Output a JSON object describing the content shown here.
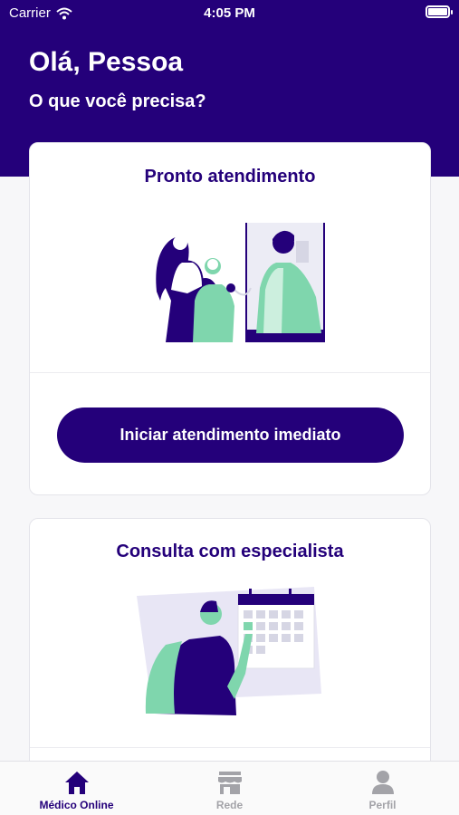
{
  "status_bar": {
    "carrier": "Carrier",
    "time": "4:05 PM",
    "battery_level": 0.9
  },
  "header": {
    "greeting": "Olá, Pessoa",
    "subtitle": "O que você precisa?"
  },
  "cards": [
    {
      "title": "Pronto atendimento",
      "button_label": "Iniciar atendimento imediato",
      "illustration": "doctor-video-call-illustration"
    },
    {
      "title": "Consulta com especialista",
      "illustration": "calendar-appointment-illustration"
    }
  ],
  "tab_bar": {
    "items": [
      {
        "label": "Médico Online",
        "icon": "home-icon",
        "active": true
      },
      {
        "label": "Rede",
        "icon": "store-icon",
        "active": false
      },
      {
        "label": "Perfil",
        "icon": "user-icon",
        "active": false
      }
    ]
  },
  "colors": {
    "primary": "#24007a",
    "accent": "#7fd6ad",
    "inactive": "#a3a3a8",
    "background": "#f7f7f9"
  }
}
